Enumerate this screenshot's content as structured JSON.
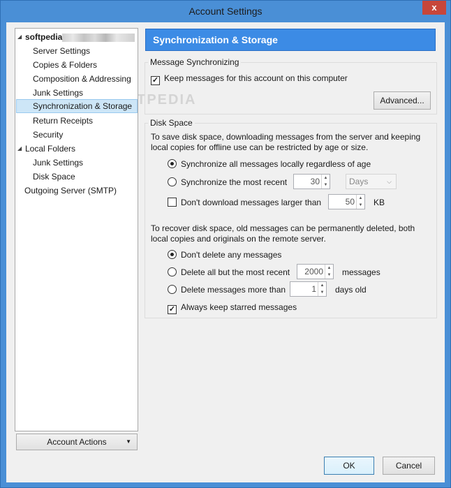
{
  "window": {
    "title": "Account Settings",
    "close_glyph": "x"
  },
  "tree": {
    "items": [
      {
        "label": "softpedia",
        "level": 0,
        "expanded": true,
        "obscured_suffix": true
      },
      {
        "label": "Server Settings",
        "level": 1
      },
      {
        "label": "Copies & Folders",
        "level": 1
      },
      {
        "label": "Composition & Addressing",
        "level": 1
      },
      {
        "label": "Junk Settings",
        "level": 1
      },
      {
        "label": "Synchronization & Storage",
        "level": 1,
        "selected": true
      },
      {
        "label": "Return Receipts",
        "level": 1
      },
      {
        "label": "Security",
        "level": 1
      },
      {
        "label": "Local Folders",
        "level": 0,
        "expanded": true
      },
      {
        "label": "Junk Settings",
        "level": 1
      },
      {
        "label": "Disk Space",
        "level": 1
      },
      {
        "label": "Outgoing Server (SMTP)",
        "level": 0
      }
    ],
    "account_actions_label": "Account Actions"
  },
  "panel": {
    "title": "Synchronization & Storage",
    "message_sync": {
      "group_label": "Message Synchronizing",
      "keep_messages_label": "Keep messages for this account on this computer",
      "keep_messages_checked": true,
      "advanced_button": "Advanced..."
    },
    "disk_space": {
      "group_label": "Disk Space",
      "download_intro": "To save disk space, downloading messages from the server and keeping local copies for offline use can be restricted by age or size.",
      "sync_all_label": "Synchronize all messages locally regardless of age",
      "sync_all_selected": true,
      "sync_recent_label": "Synchronize the most recent",
      "sync_recent_value": "30",
      "sync_recent_unit": "Days",
      "dont_download_label": "Don't download messages larger than",
      "dont_download_checked": false,
      "dont_download_value": "50",
      "dont_download_unit": "KB",
      "delete_intro": "To recover disk space, old messages can be permanently deleted, both local copies and originals on the remote server.",
      "dont_delete_label": "Don't delete any messages",
      "dont_delete_selected": true,
      "delete_all_but_label": "Delete all but the most recent",
      "delete_all_but_value": "2000",
      "delete_all_but_unit": "messages",
      "delete_older_label": "Delete messages more than",
      "delete_older_value": "1",
      "delete_older_unit": "days old",
      "keep_starred_label": "Always keep starred messages",
      "keep_starred_checked": true
    }
  },
  "footer": {
    "ok_label": "OK",
    "cancel_label": "Cancel"
  },
  "watermark": "SOFTPEDIA"
}
